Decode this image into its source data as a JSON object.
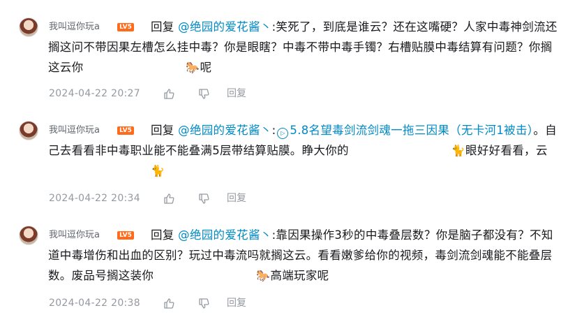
{
  "comments": [
    {
      "username": "我叫逗你玩a",
      "level": "LV5",
      "reply_prefix": "回复",
      "reply_to": "@绝园的爱花酱丶",
      "colon": ":",
      "body_before": "笑死了，到底是谁云？还在这嘴硬？人家中毒神剑流还搁这问不带因果左槽怎么挂中毒？你是眼瞎？中毒不带中毒手镯？右槽贴膜中毒结算有问题？你搁这云你",
      "emoji": "🐎",
      "body_after": "呢",
      "timestamp": "2024-04-22 20:27",
      "reply_label": "回复"
    },
    {
      "username": "我叫逗你玩a",
      "level": "LV5",
      "reply_prefix": "回复",
      "reply_to": "@绝园的爱花酱丶",
      "colon": ":",
      "link_icon": "▷",
      "link_text": "5.8名望毒剑流剑魂一拖三因果（无卡河1被击）",
      "body_before": "。自己去看看非中毒职业能不能叠满5层带结算贴膜。睁大你的",
      "emoji": "🐈",
      "body_middle": "眼好好看看，云",
      "emoji2": "🐈",
      "timestamp": "2024-04-22 20:34",
      "reply_label": "回复"
    },
    {
      "username": "我叫逗你玩a",
      "level": "LV5",
      "reply_prefix": "回复",
      "reply_to": "@绝园的爱花酱丶",
      "colon": ":",
      "body_before": "靠因果操作3秒的中毒叠层数？你是脑子都没有？不知道中毒增伤和出血的区别？玩过中毒流吗就搁这云。看看嫩爹给你的视频，毒剑流剑魂能不能叠层数。废品号搁这装你",
      "emoji": "🐎",
      "body_after": "高端玩家呢",
      "timestamp": "2024-04-22 20:38",
      "reply_label": "回复"
    }
  ]
}
